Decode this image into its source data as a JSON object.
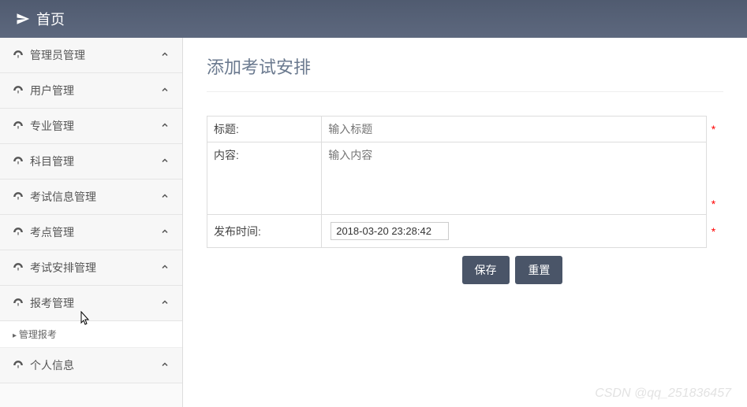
{
  "header": {
    "title": "首页"
  },
  "sidebar": {
    "items": [
      {
        "label": "管理员管理"
      },
      {
        "label": "用户管理"
      },
      {
        "label": "专业管理"
      },
      {
        "label": "科目管理"
      },
      {
        "label": "考试信息管理"
      },
      {
        "label": "考点管理"
      },
      {
        "label": "考试安排管理"
      },
      {
        "label": "报考管理"
      },
      {
        "label": "个人信息"
      }
    ],
    "sub_after_7": {
      "label": "管理报考"
    }
  },
  "main": {
    "title": "添加考试安排",
    "fields": {
      "title_label": "标题:",
      "title_placeholder": "输入标题",
      "content_label": "内容:",
      "content_placeholder": "输入内容",
      "publish_time_label": "发布时间:",
      "publish_time_value": "2018-03-20 23:28:42"
    },
    "required_marker": "*",
    "buttons": {
      "save": "保存",
      "reset": "重置"
    }
  },
  "watermark": "CSDN @qq_251836457"
}
